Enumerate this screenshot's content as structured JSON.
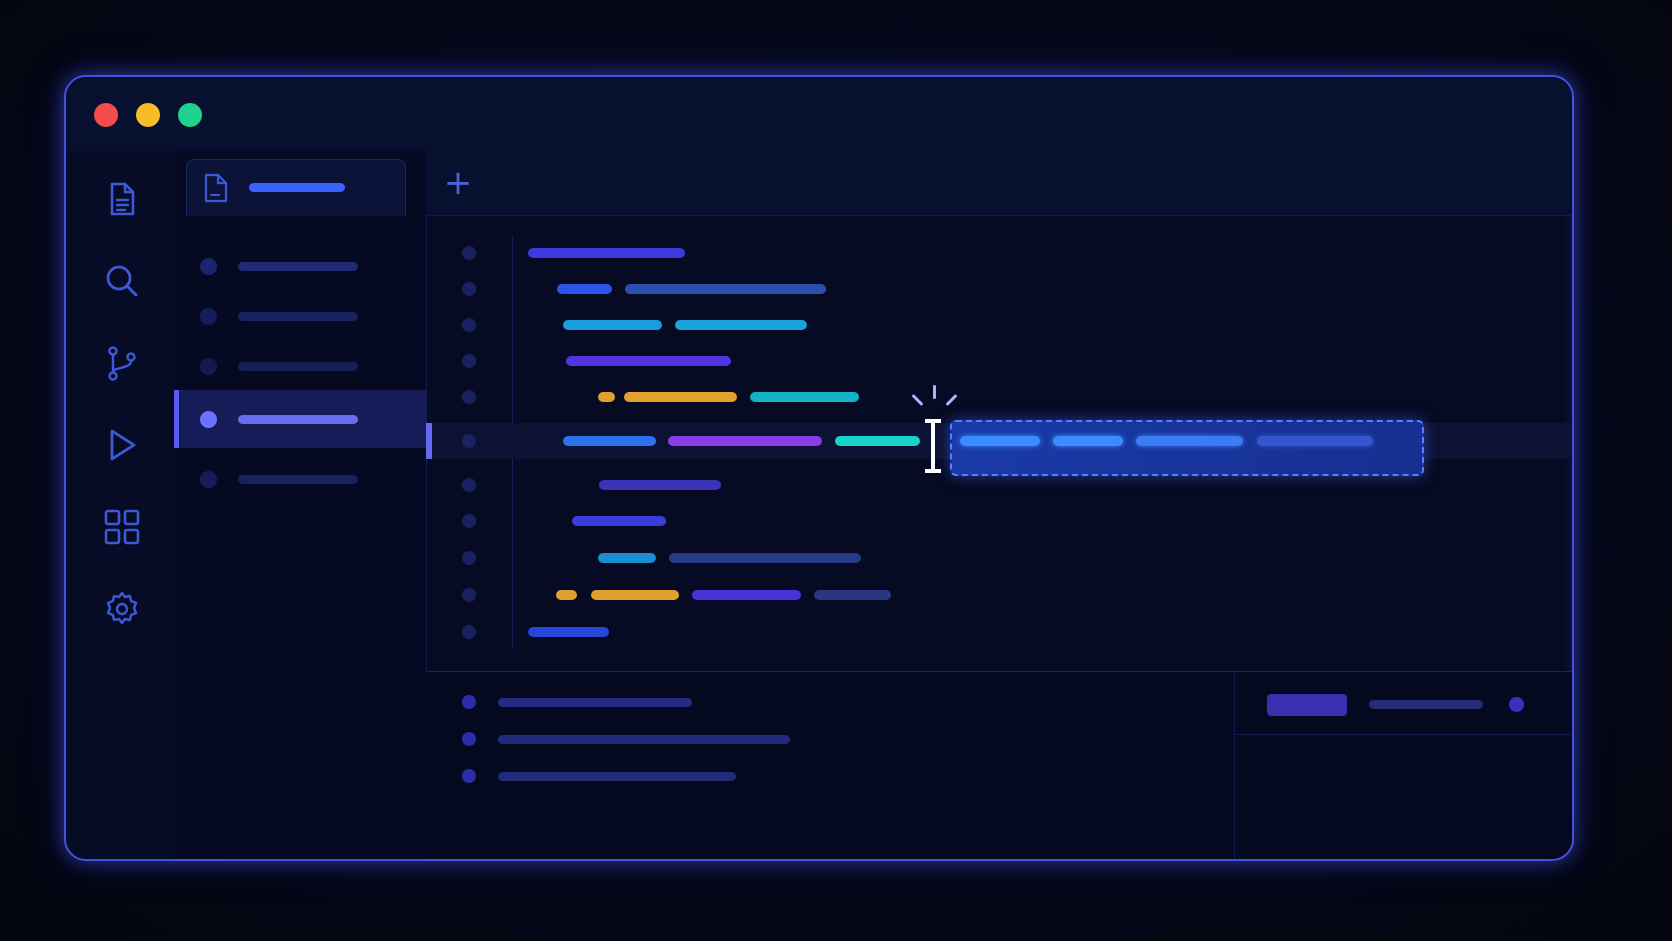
{
  "window": {
    "controls": [
      {
        "name": "close",
        "color": "#f24c4c"
      },
      {
        "name": "minimize",
        "color": "#f6bd28"
      },
      {
        "name": "maximize",
        "color": "#1fd38c"
      }
    ]
  },
  "activity_bar": {
    "icons": [
      "file-icon",
      "search-icon",
      "source-control-icon",
      "run-icon",
      "extensions-icon",
      "settings-icon"
    ],
    "color": "#3f59d6"
  },
  "explorer": {
    "open_tab_label": "",
    "files": [
      {
        "label": "",
        "active": false
      },
      {
        "label": "",
        "active": false
      },
      {
        "label": "",
        "active": false
      },
      {
        "label": "",
        "active": true
      },
      {
        "label": "",
        "active": false
      }
    ]
  },
  "editor": {
    "new_tab_icon": "plus-icon",
    "lines": [
      {
        "tokens": [
          {
            "color": "#3d38e0"
          }
        ]
      },
      {
        "tokens": [
          {
            "color": "#2a55e8"
          },
          {
            "color": "#2c4fae"
          }
        ]
      },
      {
        "tokens": [
          {
            "color": "#1a9ce0"
          },
          {
            "color": "#1aa3dc"
          }
        ]
      },
      {
        "tokens": [
          {
            "color": "#5234e2"
          }
        ]
      },
      {
        "tokens": [
          {
            "color": "#e3a02a"
          },
          {
            "color": "#e3a02a"
          },
          {
            "color": "#13b4c6"
          }
        ]
      },
      {
        "tokens": [
          {
            "color": "#2a72f0"
          },
          {
            "color": "#8a3ce8"
          },
          {
            "color": "#18d3c9"
          }
        ],
        "current": true,
        "suggestion_tokens": [
          {
            "color": "#3a8cff"
          },
          {
            "color": "#3a8cff"
          },
          {
            "color": "#3a7cf4"
          },
          {
            "color": "#3457d0"
          }
        ]
      },
      {
        "tokens": [
          {
            "color": "#3a34b8"
          }
        ]
      },
      {
        "tokens": [
          {
            "color": "#3a3ce0"
          }
        ]
      },
      {
        "tokens": [
          {
            "color": "#1a8ed0"
          },
          {
            "color": "#263a8a"
          }
        ]
      },
      {
        "tokens": [
          {
            "color": "#e0a030"
          },
          {
            "color": "#e0a030"
          },
          {
            "color": "#4a32d8"
          },
          {
            "color": "#2a3680"
          }
        ]
      },
      {
        "tokens": [
          {
            "color": "#2546d8"
          }
        ]
      }
    ]
  },
  "bottom_panel": {
    "rows": [
      {
        "text": ""
      },
      {
        "text": ""
      },
      {
        "text": ""
      }
    ],
    "status": {
      "badge": "",
      "label": "",
      "badge_color": "#3a2fb0"
    }
  }
}
